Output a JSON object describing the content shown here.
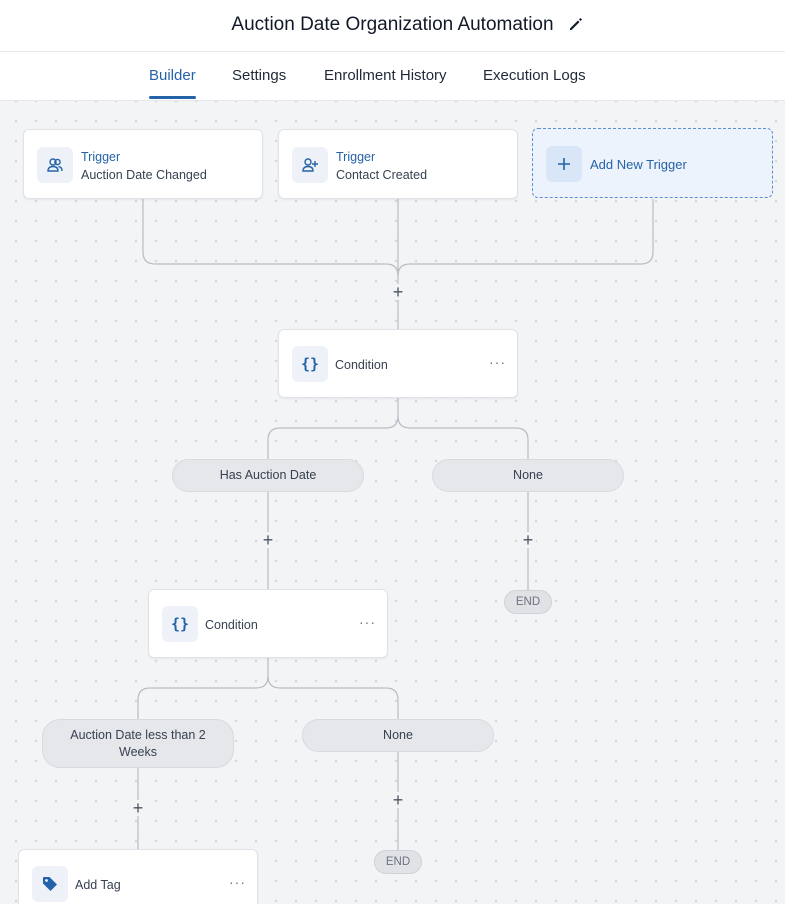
{
  "header": {
    "title": "Auction Date Organization Automation",
    "edit_icon": "pencil-icon"
  },
  "tabs": [
    {
      "label": "Builder",
      "active": true
    },
    {
      "label": "Settings",
      "active": false
    },
    {
      "label": "Enrollment History",
      "active": false
    },
    {
      "label": "Execution Logs",
      "active": false
    }
  ],
  "triggers": [
    {
      "title": "Trigger",
      "subtitle": "Auction Date Changed",
      "icon": "users-icon"
    },
    {
      "title": "Trigger",
      "subtitle": "Contact Created",
      "icon": "user-plus-icon"
    }
  ],
  "add_trigger": {
    "label": "Add New Trigger",
    "icon": "plus-icon"
  },
  "condition1": {
    "label": "Condition",
    "icon": "braces-icon",
    "menu": "···"
  },
  "branches1": [
    {
      "label": "Has Auction Date"
    },
    {
      "label": "None"
    }
  ],
  "condition2": {
    "label": "Condition",
    "icon": "braces-icon",
    "menu": "···"
  },
  "branches2": [
    {
      "label": "Auction Date less than 2 Weeks"
    },
    {
      "label": "None"
    }
  ],
  "end_label": "END",
  "add_tag": {
    "label": "Add Tag",
    "icon": "tag-icon",
    "menu": "···"
  },
  "plus_symbol": "+",
  "colors": {
    "accent": "#2563a8",
    "canvas": "#f3f4f6",
    "wire": "#b8bcc3"
  }
}
